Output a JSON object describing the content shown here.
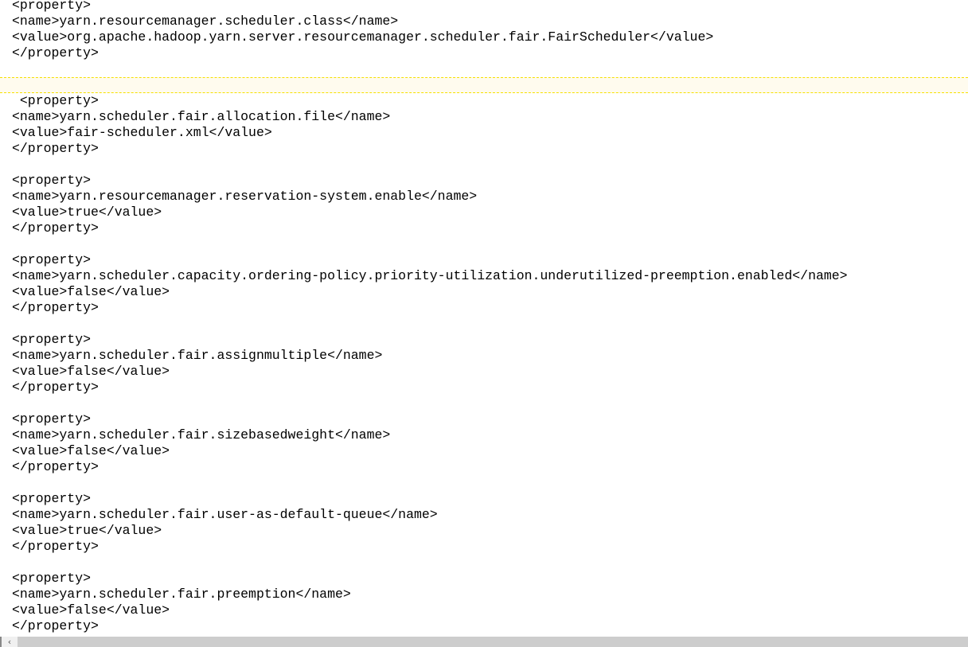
{
  "editor": {
    "current_line": 5,
    "lines": [
      "<property>",
      "<name>yarn.resourcemanager.scheduler.class</name>",
      "<value>org.apache.hadoop.yarn.server.resourcemanager.scheduler.fair.FairScheduler</value>",
      "</property>",
      "",
      "",
      " <property>",
      "<name>yarn.scheduler.fair.allocation.file</name>",
      "<value>fair-scheduler.xml</value>",
      "</property>",
      "",
      "<property>",
      "<name>yarn.resourcemanager.reservation-system.enable</name>",
      "<value>true</value>",
      "</property>",
      "",
      "<property>",
      "<name>yarn.scheduler.capacity.ordering-policy.priority-utilization.underutilized-preemption.enabled</name>",
      "<value>false</value>",
      "</property>",
      "",
      "<property>",
      "<name>yarn.scheduler.fair.assignmultiple</name>",
      "<value>false</value>",
      "</property>",
      "",
      "<property>",
      "<name>yarn.scheduler.fair.sizebasedweight</name>",
      "<value>false</value>",
      "</property>",
      "",
      "<property>",
      "<name>yarn.scheduler.fair.user-as-default-queue</name>",
      "<value>true</value>",
      "</property>",
      "",
      "<property>",
      "<name>yarn.scheduler.fair.preemption</name>",
      "<value>false</value>",
      "</property>"
    ]
  },
  "scrollbar": {
    "left_arrow_icon": "chevron-left-icon",
    "left_arrow": "‹"
  }
}
